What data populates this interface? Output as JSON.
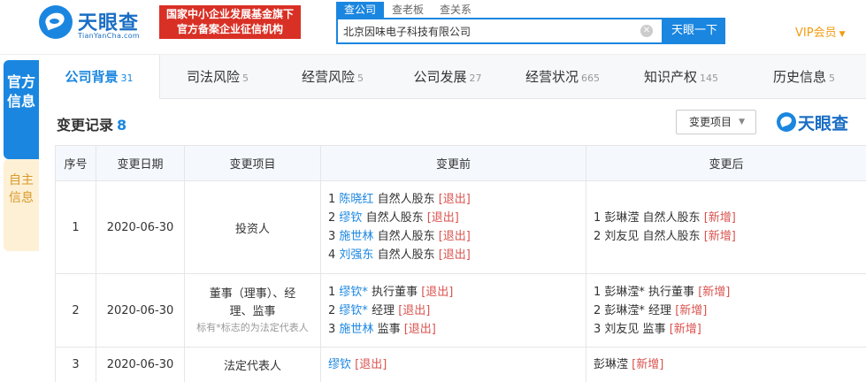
{
  "header": {
    "logo_text": "天眼查",
    "logo_sub": "TianYanCha.com",
    "promo_line1": "国家中小企业发展基金旗下",
    "promo_line2": "官方备案企业征信机构",
    "search_tabs": [
      "查公司",
      "查老板",
      "查关系"
    ],
    "search_value": "北京因味电子科技有限公司",
    "search_button": "天眼一下",
    "vip_label": "VIP会员"
  },
  "side_tabs": {
    "official": "官方信息",
    "self": "自主信息"
  },
  "category_tabs": [
    {
      "label": "公司背景",
      "count": "31"
    },
    {
      "label": "司法风险",
      "count": "5"
    },
    {
      "label": "经营风险",
      "count": "5"
    },
    {
      "label": "公司发展",
      "count": "27"
    },
    {
      "label": "经营状况",
      "count": "665"
    },
    {
      "label": "知识产权",
      "count": "145"
    },
    {
      "label": "历史信息",
      "count": "5"
    }
  ],
  "section": {
    "title": "变更记录",
    "count": "8",
    "filter_label": "变更项目",
    "brand": "天眼查"
  },
  "table": {
    "headers": [
      "序号",
      "变更日期",
      "变更项目",
      "变更前",
      "变更后"
    ],
    "rows": [
      {
        "index": "1",
        "date": "2020-06-30",
        "item": "投资人",
        "before": [
          {
            "num": "1",
            "name": "陈晓红",
            "role": "自然人股东",
            "tag": "[退出]"
          },
          {
            "num": "2",
            "name": "缪钦",
            "role": "自然人股东",
            "tag": "[退出]"
          },
          {
            "num": "3",
            "name": "施世林",
            "role": "自然人股东",
            "tag": "[退出]"
          },
          {
            "num": "4",
            "name": "刘强东",
            "role": "自然人股东",
            "tag": "[退出]"
          }
        ],
        "after": [
          {
            "text": "1 彭琳滢 自然人股东",
            "tag": "[新增]"
          },
          {
            "text": "2 刘友见 自然人股东",
            "tag": "[新增]"
          }
        ]
      },
      {
        "index": "2",
        "date": "2020-06-30",
        "item_line1": "董事（理事）、经",
        "item_line2": "理、监事",
        "note": "标有*标志的为法定代表人",
        "before": [
          {
            "num": "1",
            "name": "缪钦*",
            "role": "执行董事",
            "tag": "[退出]"
          },
          {
            "num": "2",
            "name": "缪钦*",
            "role": "经理",
            "tag": "[退出]"
          },
          {
            "num": "3",
            "name": "施世林",
            "role": "监事",
            "tag": "[退出]"
          }
        ],
        "after": [
          {
            "text": "1 彭琳滢* 执行董事",
            "tag": "[新增]"
          },
          {
            "text": "2 彭琳滢* 经理",
            "tag": "[新增]"
          },
          {
            "text": "3 刘友见 监事",
            "tag": "[新增]"
          }
        ]
      },
      {
        "index": "3",
        "date": "2020-06-30",
        "item": "法定代表人",
        "before": [
          {
            "name": "缪钦",
            "tag": "[退出]"
          }
        ],
        "after": [
          {
            "text": "彭琳滢",
            "tag": "[新增]"
          }
        ]
      }
    ]
  }
}
